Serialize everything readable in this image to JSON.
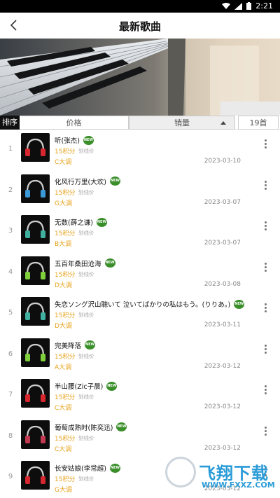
{
  "status": {
    "time": "2:21"
  },
  "header": {
    "title": "最新歌曲"
  },
  "sort": {
    "label": "排序",
    "price": "价格",
    "sales": "销量",
    "count": "19首"
  },
  "songs": [
    {
      "idx": "1",
      "name": "听(张杰)",
      "price": "15积分",
      "buy": "划线价",
      "key": "C大调",
      "date": "2023-03-10",
      "phone_color": "#d8262f",
      "badge": "NEW"
    },
    {
      "idx": "2",
      "name": "化风行万里(大欢)",
      "price": "15积分",
      "buy": "划线价",
      "key": "G大调",
      "date": "2023-03-07",
      "phone_color": "#3a9ad9",
      "badge": "NEW"
    },
    {
      "idx": "3",
      "name": "无数(薛之谦)",
      "price": "15积分",
      "buy": "划线价",
      "key": "B大调",
      "date": "2023-03-07",
      "phone_color": "#3fb0a0",
      "badge": "NEW"
    },
    {
      "idx": "4",
      "name": "五百年桑田沧海",
      "price": "15积分",
      "buy": "划线价",
      "key": "D大调",
      "date": "2023-03-08",
      "phone_color": "#7ecf3a",
      "badge": "NEW"
    },
    {
      "idx": "5",
      "name": "失恋ソング沢山聴いて 泣いてばかりの私はもう。(りりあ。)",
      "price": "15积分",
      "buy": "划线价",
      "key": "D大调",
      "date": "2023-03-11",
      "phone_color": "#3fb0a0",
      "badge": "NEW"
    },
    {
      "idx": "6",
      "name": "完美降落",
      "price": "15积分",
      "buy": "划线价",
      "key": "A大调",
      "date": "2023-03-12",
      "phone_color": "#7ecf3a",
      "badge": "NEW"
    },
    {
      "idx": "7",
      "name": "半山腰(Zic子晨)",
      "price": "15积分",
      "buy": "划线价",
      "key": "C大调",
      "date": "2023-03-12",
      "phone_color": "#d8262f",
      "badge": "NEW"
    },
    {
      "idx": "8",
      "name": "葡萄成熟时(陈奕迅)",
      "price": "15积分",
      "buy": "划线价",
      "key": "C大调",
      "date": "2023-03-12",
      "phone_color": "#c23a52",
      "badge": "NEW"
    },
    {
      "idx": "9",
      "name": "长安姑娘(李常超)",
      "price": "15积分",
      "buy": "划线价",
      "key": "G大调",
      "date": "2023-03-12",
      "phone_color": "#d8262f",
      "badge": "NEW"
    }
  ],
  "watermark": {
    "title": "飞翔下载",
    "url": "WWW.FXXZ.COM"
  }
}
